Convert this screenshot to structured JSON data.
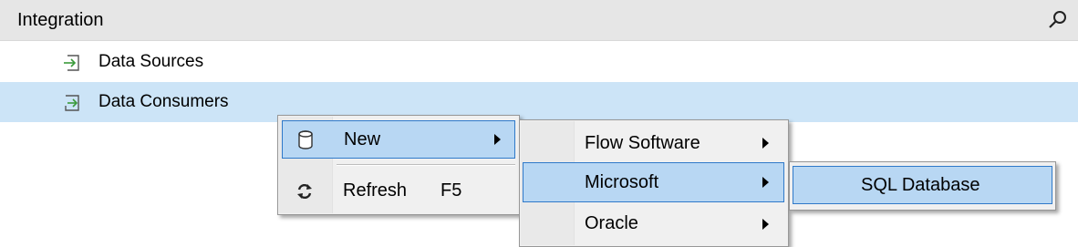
{
  "header": {
    "title": "Integration",
    "search_icon": "search-icon"
  },
  "tree": {
    "items": [
      {
        "label": "Data Sources",
        "icon": "arrow-into-box-icon",
        "selected": false
      },
      {
        "label": "Data Consumers",
        "icon": "arrow-into-box-icon",
        "selected": true
      }
    ]
  },
  "context_menu": {
    "items": [
      {
        "label": "New",
        "icon": "database-icon",
        "submenu": true,
        "highlighted": true
      },
      {
        "label": "Refresh",
        "shortcut": "F5",
        "icon": "refresh-icon",
        "submenu": false
      }
    ]
  },
  "new_submenu": {
    "items": [
      {
        "label": "Flow Software",
        "submenu": true
      },
      {
        "label": "Microsoft",
        "submenu": true,
        "highlighted": true
      },
      {
        "label": "Oracle",
        "submenu": true
      }
    ]
  },
  "microsoft_submenu": {
    "items": [
      {
        "label": "SQL Database",
        "highlighted": true
      }
    ]
  },
  "colors": {
    "header_bg": "#e6e6e6",
    "selected_row": "#cce4f7",
    "menu_bg": "#f0f0f0",
    "menu_highlight": "#b8d7f3",
    "menu_highlight_border": "#2f79c9",
    "icon_green": "#3a9a3a"
  }
}
